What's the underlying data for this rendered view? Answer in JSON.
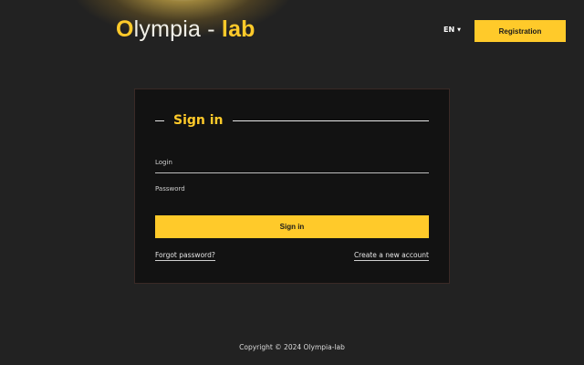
{
  "header": {
    "logo_first": "O",
    "logo_mid": "lympia - ",
    "logo_end": "lab",
    "language": "EN",
    "registration_label": "Registration"
  },
  "login_card": {
    "title": "Sign in",
    "login_label": "Login",
    "password_label": "Password",
    "signin_label": "Sign in",
    "forgot_label": "Forgot password?",
    "create_label": "Create a new account"
  },
  "footer": {
    "copyright": "Copyright © 2024 Olympia-lab"
  },
  "colors": {
    "accent": "#ffca2a",
    "background": "#222222",
    "card": "#121212"
  },
  "icons": {
    "language_caret": "caret-down-icon"
  }
}
